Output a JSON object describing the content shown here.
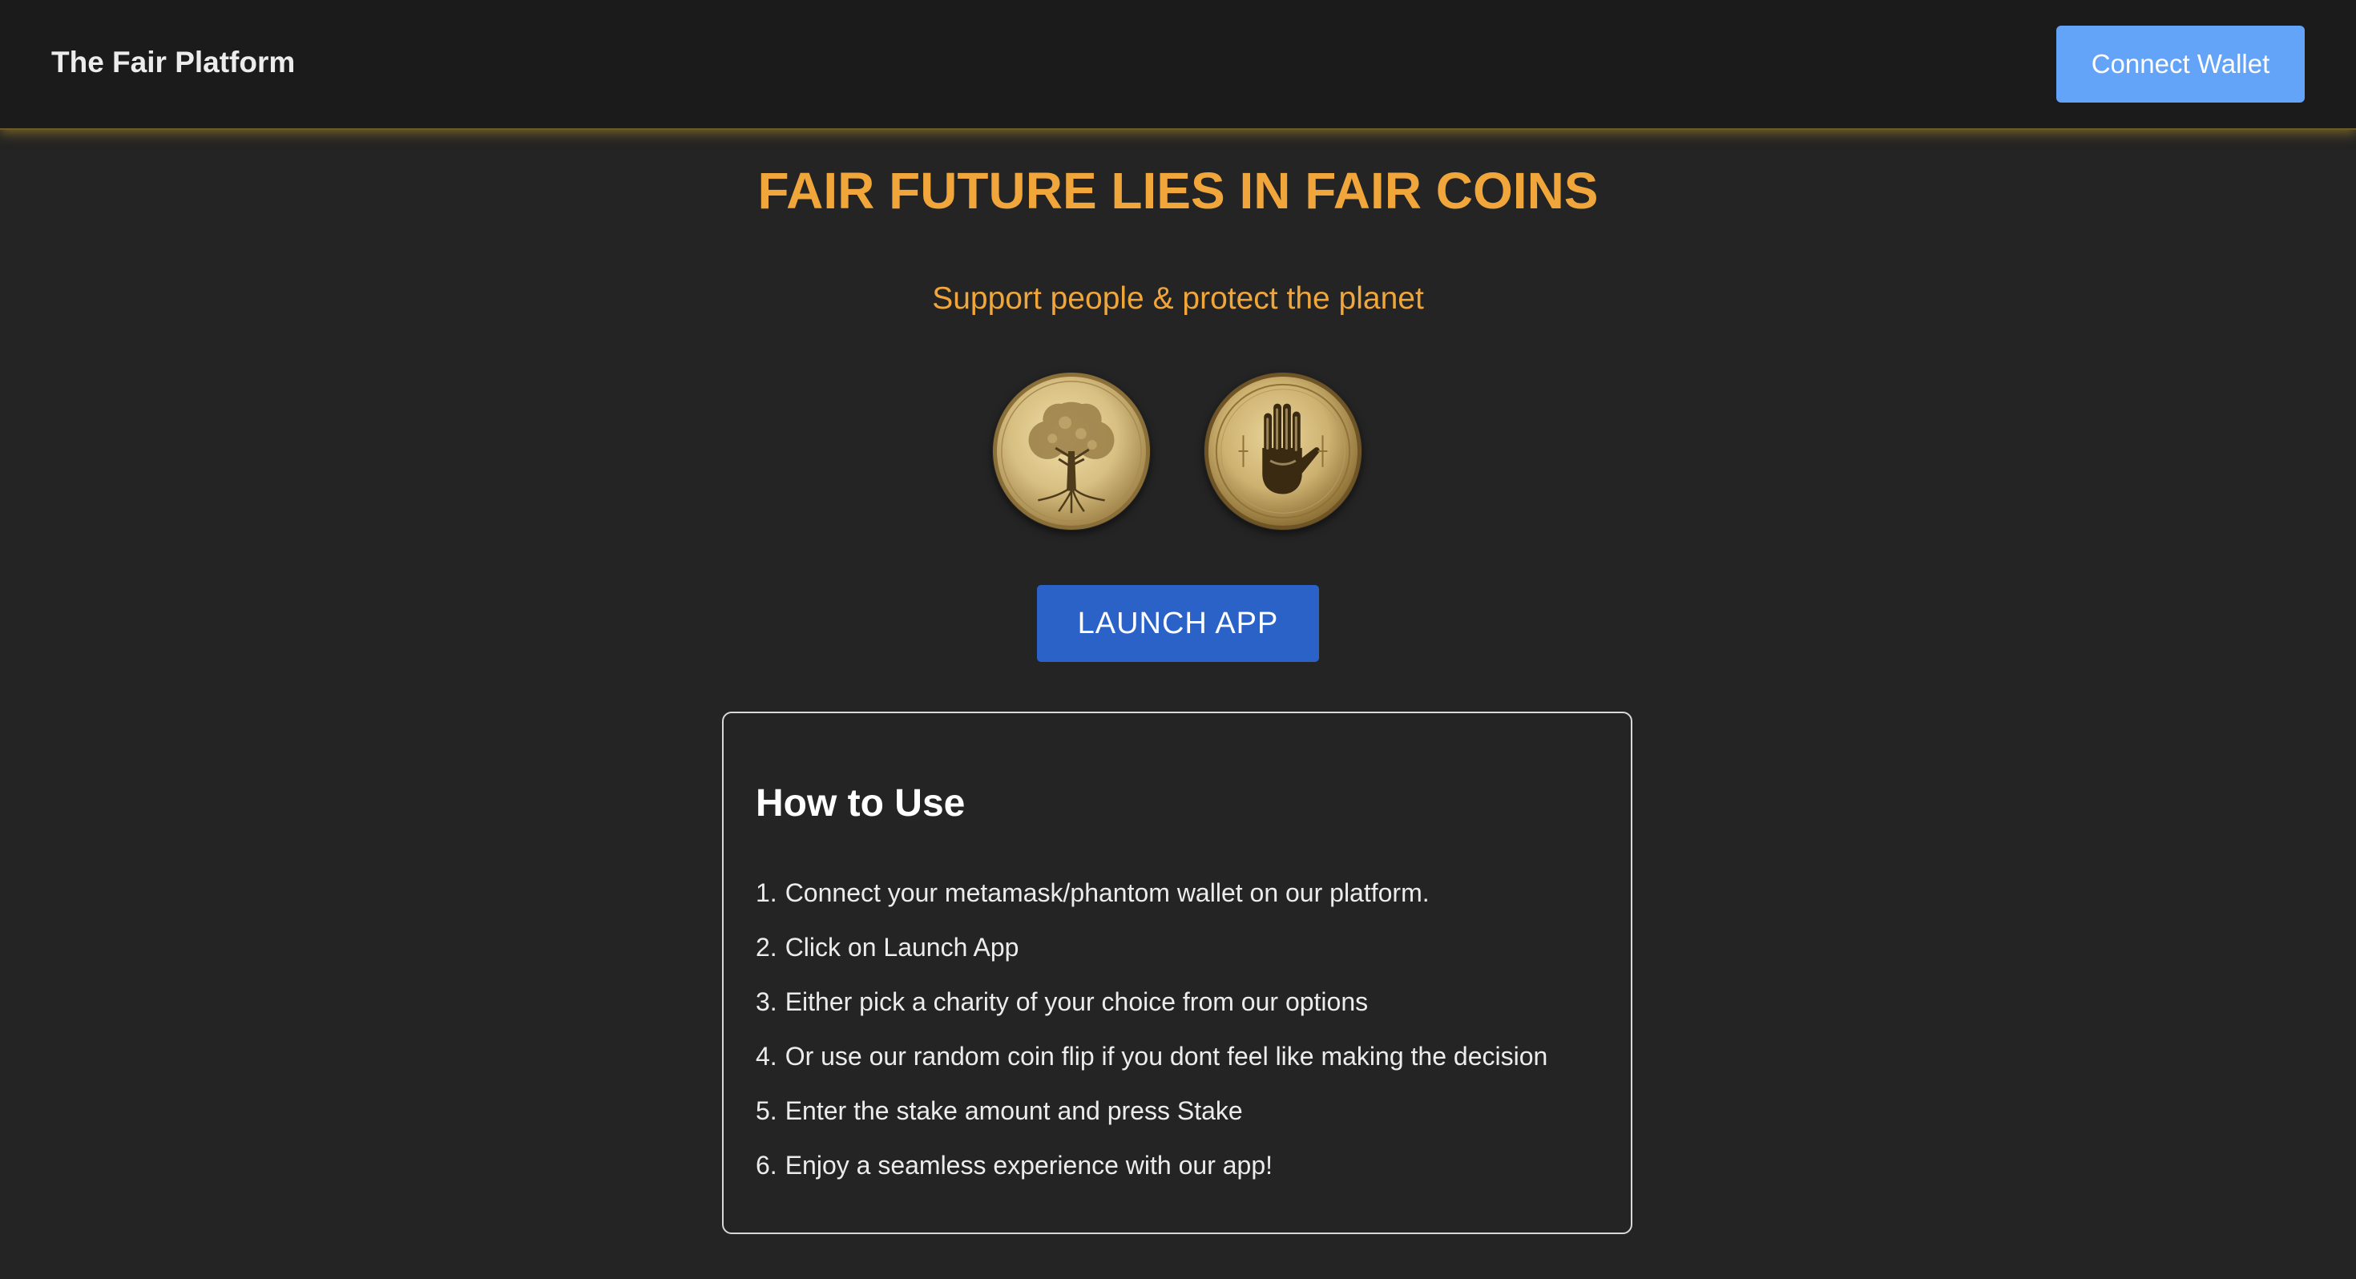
{
  "header": {
    "brand": "The Fair Platform",
    "connect_wallet_label": "Connect Wallet"
  },
  "hero": {
    "title": "FAIR FUTURE LIES IN FAIR COINS",
    "subtitle": "Support people & protect the planet",
    "coins": [
      {
        "name": "tree-coin-icon"
      },
      {
        "name": "raised-hand-coin-icon"
      }
    ],
    "launch_label": "LAUNCH APP"
  },
  "how_to_use": {
    "title": "How to Use",
    "steps": [
      {
        "num": "1.",
        "text": "Connect your metamask/phantom wallet on our platform."
      },
      {
        "num": "2.",
        "text": "Click on Launch App"
      },
      {
        "num": "3.",
        "text": "Either pick a charity of your choice from our options"
      },
      {
        "num": "4.",
        "text": "Or use our random coin flip if you dont feel like making the decision"
      },
      {
        "num": "5.",
        "text": "Enter the stake amount and press Stake"
      },
      {
        "num": "6.",
        "text": "Enjoy a seamless experience with our app!"
      }
    ]
  },
  "colors": {
    "background": "#242424",
    "navbar": "#1b1b1b",
    "accent_orange": "#f0a63a",
    "connect_button": "#64a4f8",
    "launch_button": "#2a62c8",
    "coin_gold": "#d9c187"
  }
}
